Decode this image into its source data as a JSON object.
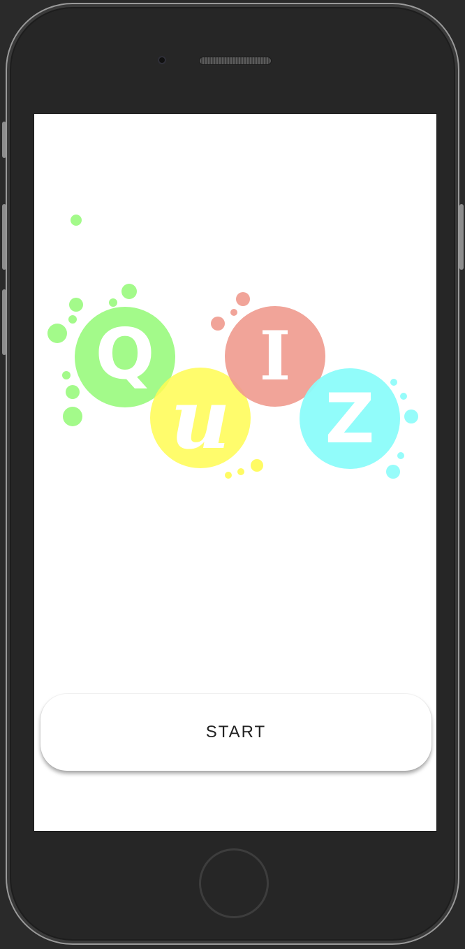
{
  "logo": {
    "letters": {
      "q": "Q",
      "u": "u",
      "i": "I",
      "z": "Z"
    },
    "colors": {
      "q": "#99fa7d",
      "u": "#fffb52",
      "i": "#f09a8e",
      "z": "#8bfcfa"
    }
  },
  "start_button": {
    "label": "START"
  }
}
